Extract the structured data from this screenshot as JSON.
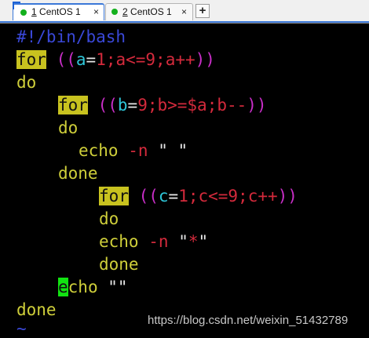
{
  "tabs": [
    {
      "number": "1",
      "name": " CentOS 1",
      "close": "×",
      "active": true
    },
    {
      "number": "2",
      "name": " CentOS 1",
      "close": "×",
      "active": false
    }
  ],
  "add_tab": "+",
  "colors": {
    "status_dot": "#13b01d",
    "accent": "#3b78d8",
    "terminal_bg": "#000000",
    "highlight": "#c8c21f",
    "cursor": "#12e312"
  },
  "script": {
    "shebang": "#!/bin/bash",
    "l2": {
      "for": "for",
      "open": " ((",
      "a1": "a",
      "eq": "=",
      "one": "1",
      "rest": ";a<=9;a++",
      "close": "))"
    },
    "l3": "do",
    "l4": {
      "for": "for",
      "open": " ((",
      "b1": "b",
      "eq": "=",
      "nine": "9",
      "rest": ";b>=$a;b--",
      "close": "))"
    },
    "l5": "do",
    "l6": {
      "echo": "echo",
      "flag": "-n",
      "str1": "\"",
      "str2": " ",
      "str3": "\""
    },
    "l7": "done",
    "l8": {
      "for": "for",
      "open": " ((",
      "c1": "c",
      "eq": "=",
      "one": "1",
      "rest": ";c<=9;c++",
      "close": "))"
    },
    "l9": "do",
    "l10": {
      "echo": "echo",
      "flag": "-n",
      "str1": "\"",
      "star": "*",
      "str3": "\""
    },
    "l11": "done",
    "l12": {
      "cursor": "e",
      "rest": "cho",
      "str": "\"\""
    },
    "l13": "done",
    "tilde": "~"
  },
  "watermark": "https://blog.csdn.net/weixin_51432789"
}
